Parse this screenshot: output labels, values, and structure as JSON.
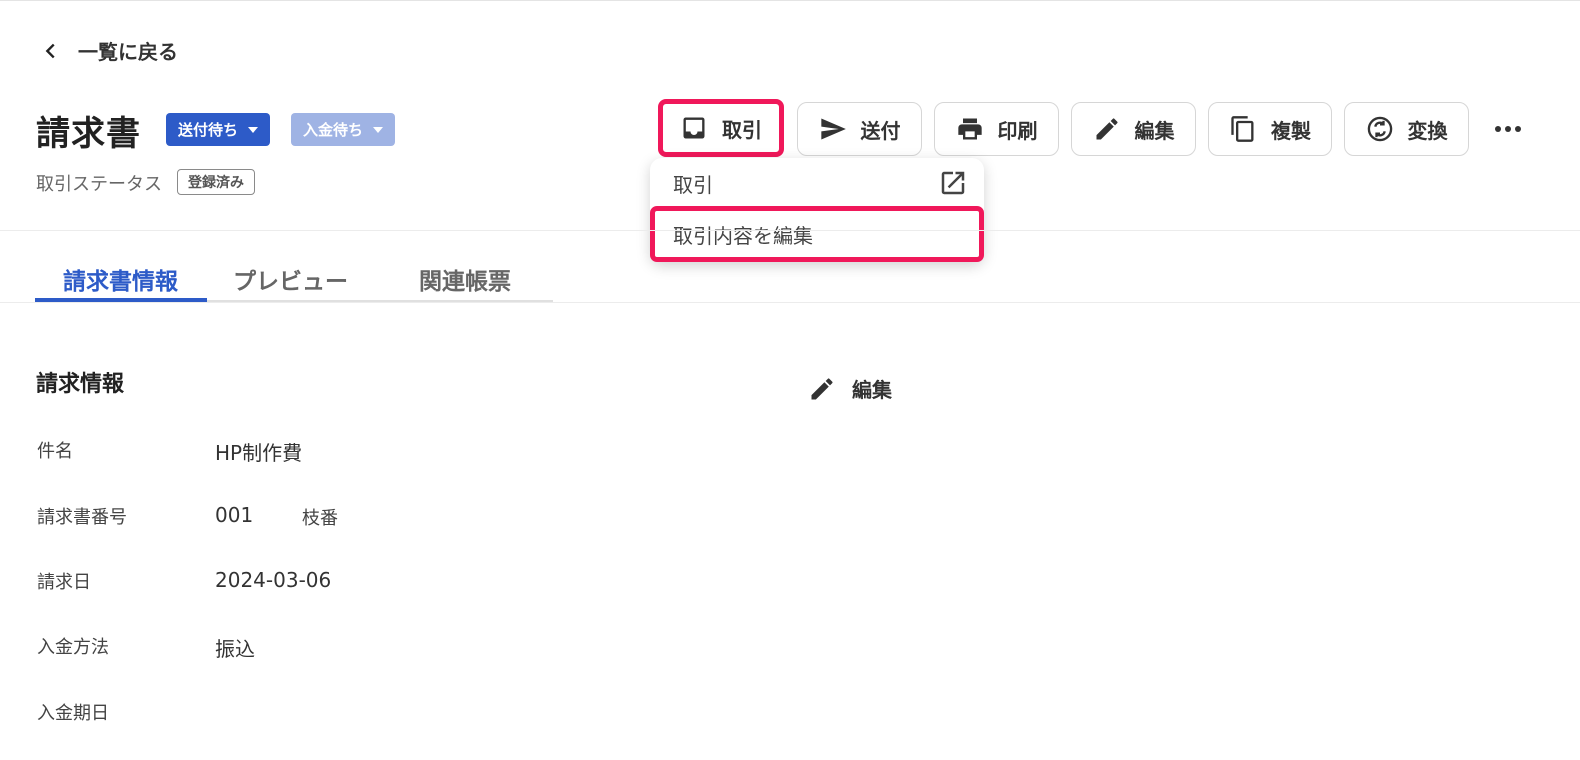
{
  "nav": {
    "back_label": "一覧に戻る"
  },
  "header": {
    "title": "請求書",
    "status_send": "送付待ち",
    "status_payment": "入金待ち",
    "deal_status_label": "取引ステータス",
    "deal_status_badge": "登録済み"
  },
  "toolbar": {
    "deal": "取引",
    "send": "送付",
    "print": "印刷",
    "edit": "編集",
    "copy": "複製",
    "convert": "変換"
  },
  "dropdown": {
    "item_deal": "取引",
    "item_edit_deal": "取引内容を編集"
  },
  "tabs": {
    "info": "請求書情報",
    "preview": "プレビュー",
    "related": "関連帳票"
  },
  "section": {
    "title": "請求情報",
    "edit_label": "編集",
    "fields": [
      {
        "label": "件名",
        "value": "HP制作費"
      },
      {
        "label": "請求書番号",
        "value": "001"
      },
      {
        "label": "請求日",
        "value": "2024-03-06"
      },
      {
        "label": "入金方法",
        "value": "振込"
      },
      {
        "label": "入金期日",
        "value": ""
      }
    ],
    "branch_label": "枝番"
  },
  "colors": {
    "primary": "#2d5bc8",
    "primary_light": "#9fb3e4",
    "highlight": "#f0185a"
  }
}
